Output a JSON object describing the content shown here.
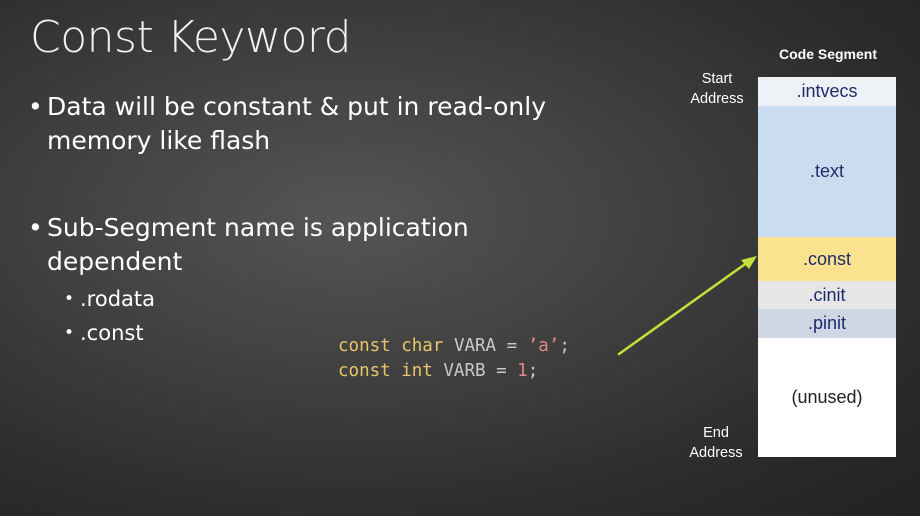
{
  "slide": {
    "title": "Const Keyword",
    "bullets": [
      {
        "line1": "Data will be constant & put in read-only",
        "line2": "memory like flash"
      },
      {
        "line1": "Sub-Segment name is application",
        "line2": "dependent"
      }
    ],
    "sub_bullets": [
      ".rodata",
      ".const"
    ],
    "code": {
      "line1": {
        "kw1": "const",
        "kw2": "char",
        "rest": "VARA =",
        "lit": "’a’",
        "end": ";"
      },
      "line2": {
        "kw1": "const",
        "kw2": "int",
        "rest": "VARB =",
        "lit": "1",
        "end": ";"
      }
    }
  },
  "diagram": {
    "title": "Code Segment",
    "start_label": [
      "Start",
      "Address"
    ],
    "end_label": [
      "End",
      "Address"
    ],
    "segments": [
      {
        "label": ".intvecs",
        "color": "#eef1f6"
      },
      {
        "label": ".text",
        "color": "#c9dcf0"
      },
      {
        "label": ".const",
        "color": "#fbe28e"
      },
      {
        "label": ".cinit",
        "color": "#e6e6e6"
      },
      {
        "label": ".pinit",
        "color": "#cfd7e4"
      },
      {
        "label": "(unused)",
        "color": "#ffffff"
      }
    ],
    "arrow_color": "#c6e03a"
  }
}
